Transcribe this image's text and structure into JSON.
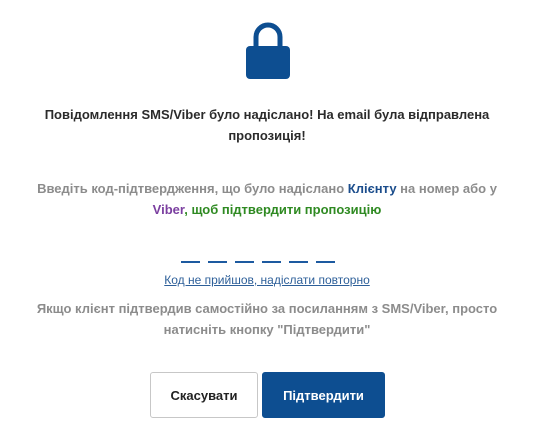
{
  "dialog": {
    "icon": "lock-icon",
    "headline": "Повідомлення SMS/Viber було надіслано! На email була відправлена пропозиція!",
    "instruction": {
      "part1": "Введіть код-підтвердження, що було надіслано ",
      "client": "Клієнту",
      "part2": " на номер або у ",
      "viber": "Viber",
      "part3": ", щоб підтвердити пропозицію"
    },
    "code_inputs": [
      "",
      "",
      "",
      "",
      "",
      ""
    ],
    "resend_link": "Код не прийшов, надіслати повторно",
    "note": "Якщо клієнт підтвердив самостійно за посиланням з SMS/Viber, просто натисніть кнопку \"Підтвердити\"",
    "buttons": {
      "cancel": "Скасувати",
      "confirm": "Підтвердити"
    }
  },
  "colors": {
    "accent": "#0d4e91",
    "client_link": "#1b4d8c",
    "viber": "#7b3fa0",
    "green": "#2f8a22",
    "muted_text": "#8c8c8c"
  }
}
